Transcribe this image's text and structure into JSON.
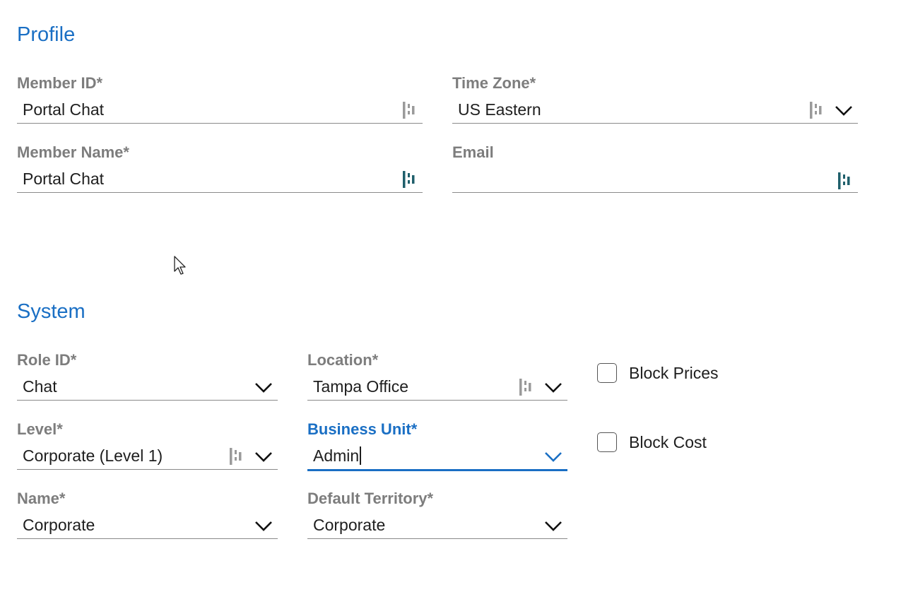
{
  "profile": {
    "title": "Profile",
    "member_id": {
      "label": "Member ID*",
      "value": "Portal Chat"
    },
    "time_zone": {
      "label": "Time Zone*",
      "value": "US Eastern"
    },
    "member_name": {
      "label": "Member Name*",
      "value": "Portal Chat"
    },
    "email": {
      "label": "Email",
      "value": ""
    }
  },
  "system": {
    "title": "System",
    "role_id": {
      "label": "Role ID*",
      "value": "Chat"
    },
    "location": {
      "label": "Location*",
      "value": "Tampa Office"
    },
    "level": {
      "label": "Level*",
      "value": "Corporate (Level 1)"
    },
    "business_unit": {
      "label": "Business Unit*",
      "value": "Admin"
    },
    "name": {
      "label": "Name*",
      "value": "Corporate"
    },
    "default_territory": {
      "label": "Default Territory*",
      "value": "Corporate"
    },
    "block_prices": {
      "label": "Block Prices",
      "checked": false
    },
    "block_cost": {
      "label": "Block Cost",
      "checked": false
    }
  },
  "colors": {
    "accent": "#1a6fc4",
    "label_gray": "#7d7d7d",
    "lookup_icon_gray": "#9a9a9a",
    "lookup_icon_teal": "#1f5f6b"
  },
  "icons": {
    "lookup": "lookup-icon",
    "dropdown": "chevron-down-icon",
    "pointer": "mouse-pointer-icon"
  }
}
